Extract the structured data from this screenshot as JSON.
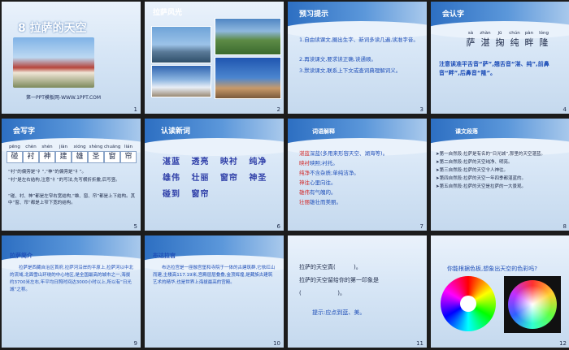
{
  "slides": [
    {
      "num": "1",
      "title": "8 拉萨的天空",
      "footer": "第一PPT模板网-WWW.1PPT.COM"
    },
    {
      "num": "2",
      "title": "拉萨风光"
    },
    {
      "num": "3",
      "title": "预习提示",
      "lines": [
        "1.自由读课文,圈出生字、新词多读几遍,读准字音。",
        "2.再读课文,要求读正确,读通顺。",
        "3.默读课文,联系上下文或查词典理解词义。"
      ]
    },
    {
      "num": "4",
      "title": "会认字",
      "pinyin": [
        "sà",
        "zhàn",
        "jū",
        "chún",
        "pàn",
        "lóng"
      ],
      "chars": [
        "萨",
        "湛",
        "掬",
        "纯",
        "畔",
        "隆"
      ],
      "note": "注意读准平舌音“萨”,翘舌音“湛、纯”,前鼻音“畔”,后鼻音“隆”。"
    },
    {
      "num": "5",
      "title": "会写字",
      "pinyin": [
        "pēng",
        "chèn",
        "shén",
        "jiàn",
        "xióng",
        "shèng",
        "chuāng",
        "lián"
      ],
      "chars": [
        "碰",
        "衬",
        "神",
        "建",
        "雄",
        "圣",
        "窗",
        "帘"
      ],
      "note1": "“衬”的偏旁是“礻”,“神”的偏旁是“礻”。",
      "note2": "“衬”是左右结构,注意“礻”的写法,先写横折折撇,后写竖。",
      "note3": "“碰、衬、神”都是左窄右宽结构,“雄、窗、帘”都是上下结构。其中“窗、帘”都是上窄下宽的结构。"
    },
    {
      "num": "6",
      "title": "认读新词",
      "row1": "湛蓝   透亮   映衬   纯净",
      "row2": "雄伟   壮丽   窗帘   神圣",
      "row3": "碰到   窗帘"
    },
    {
      "num": "7",
      "title": "词语解释",
      "lines": [
        [
          "湛蓝",
          "深蓝(多用来形容天空、湖海等)。"
        ],
        [
          "映衬",
          "映照;衬托。"
        ],
        [
          "纯净",
          "不含杂质;单纯洁净。"
        ],
        [
          "神往",
          "心里向往。"
        ],
        [
          "雄伟",
          "有气魄的。"
        ],
        [
          "壮丽",
          "雄壮而美丽。"
        ]
      ]
    },
    {
      "num": "8",
      "title": "课文段落",
      "lines": [
        "➤第一自然段:拉萨是有名的“日光城”,那里的天空湛蓝。",
        "➤第二自然段:拉萨的天空纯净、明亮。",
        "➤第三自然段:拉萨的天空令人神往。",
        "➤第四自然段:拉萨的天空一年四季都湛蓝的。",
        "➤第五自然段:拉萨的天空是拉萨的一大景观。"
      ]
    },
    {
      "num": "9",
      "title": "拉萨简介",
      "body": "拉萨是西藏自治区首府,拉萨河沿岸的平原上,拉萨河以中北的流域,北面雪山环绕的中心地区,是全国最高的城市之一,海拔约3700米左右,年平均日照时间达3000小时以上,所以有“日光城”之称。"
    },
    {
      "num": "10",
      "title": "布达拉宫",
      "body": "布达拉宫是一座融宫堡和寺院于一体的古建筑群,它依红山而建,主楼高117.19米,宫殿层层叠叠,金顶辉煌,是藏族古建筑艺术的精华,也是世界上海拔最高的宫殿。"
    },
    {
      "num": "11",
      "lines": [
        "拉萨的天空真(          )。",
        "拉萨的天空留给你的第一印象是",
        "(                    )。"
      ],
      "hint": "提示:应点到蓝、美。"
    },
    {
      "num": "12",
      "question": "你能根据色板,想象出天空的色彩吗?"
    }
  ]
}
